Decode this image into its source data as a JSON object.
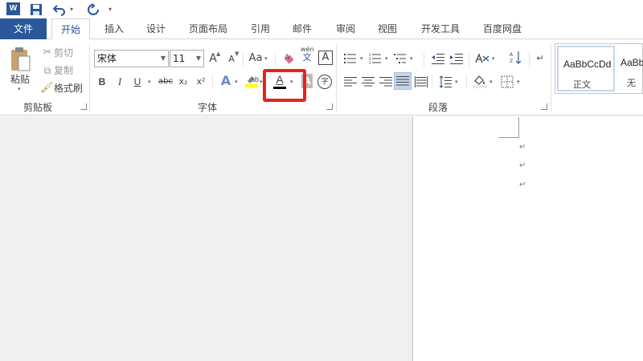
{
  "qat": {
    "logo": "W",
    "save_icon": "save-icon",
    "undo_icon": "undo-icon",
    "redo_icon": "redo-icon"
  },
  "tabs": [
    {
      "label": "文件"
    },
    {
      "label": "开始"
    },
    {
      "label": "插入"
    },
    {
      "label": "设计"
    },
    {
      "label": "页面布局"
    },
    {
      "label": "引用"
    },
    {
      "label": "邮件"
    },
    {
      "label": "审阅"
    },
    {
      "label": "视图"
    },
    {
      "label": "开发工具"
    },
    {
      "label": "百度网盘"
    }
  ],
  "clipboard": {
    "paste": "粘贴",
    "cut": "剪切",
    "copy": "复制",
    "format_painter": "格式刷",
    "group": "剪贴板"
  },
  "font": {
    "family": "宋体",
    "size": "11",
    "group": "字体",
    "phonetic": "wén",
    "phonetic_char": "文",
    "enclose_char": "字",
    "bold": "B",
    "italic": "I",
    "underline": "U",
    "strike": "abc",
    "subscript": "x₂",
    "superscript": "x²",
    "grow": "A",
    "shrink": "A",
    "case": "Aa",
    "color_letter": "A",
    "effects_letter": "A",
    "shade_letter": "A"
  },
  "paragraph": {
    "group": "段落"
  },
  "styles": {
    "items": [
      {
        "sample": "AaBbCcDd",
        "name": "正文"
      },
      {
        "sample": "AaBb",
        "name": "无"
      }
    ]
  },
  "colors": {
    "accent": "#2b579a",
    "highlight_box": "#e8231b",
    "highlighter": "#ffff00"
  },
  "document": {
    "para_mark": "↵"
  }
}
